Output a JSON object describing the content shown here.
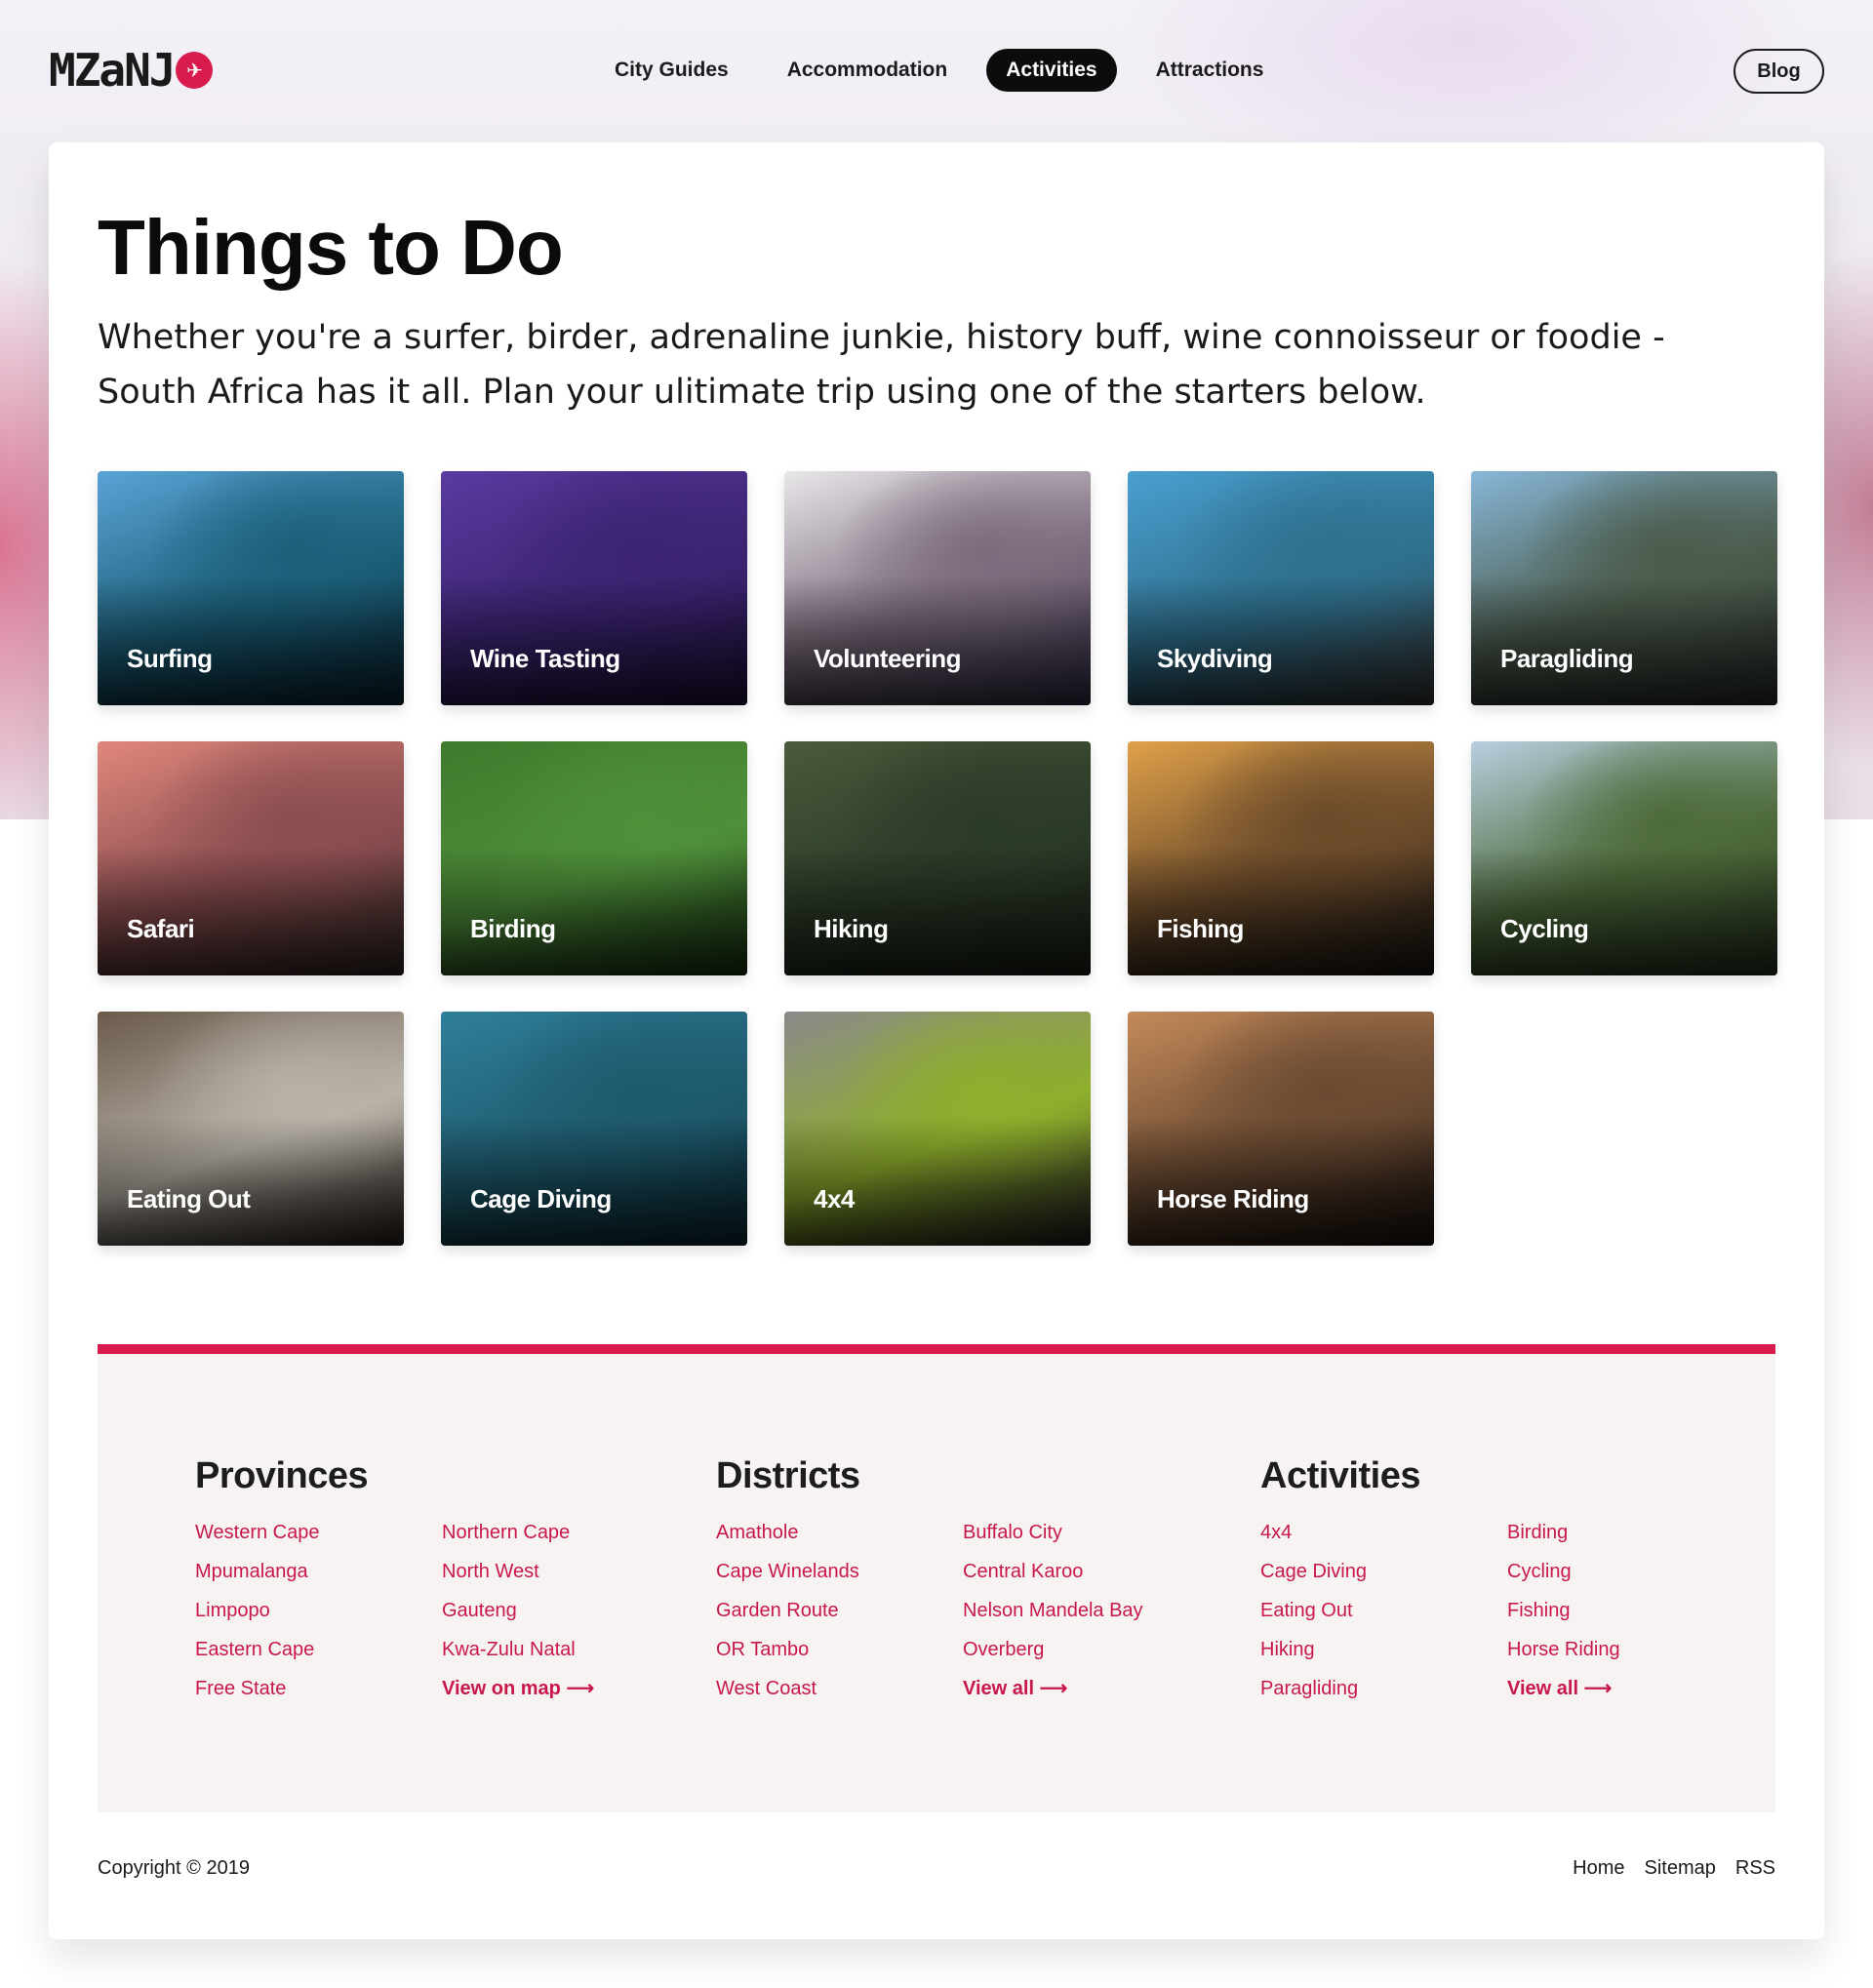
{
  "brand": {
    "logo_text": "MZaNJ",
    "logo_mark": "✈"
  },
  "nav": {
    "items": [
      {
        "label": "City Guides"
      },
      {
        "label": "Accommodation"
      },
      {
        "label": "Activities"
      },
      {
        "label": "Attractions"
      }
    ],
    "active": "Activities",
    "blog_label": "Blog"
  },
  "page": {
    "title": "Things to Do",
    "intro": "Whether you're a surfer, birder, adrenaline junkie, history buff, wine connoisseur or foodie - South Africa has it all. Plan your ulitimate trip using one of the starters below."
  },
  "activities": [
    {
      "label": "Surfing",
      "colors": [
        "#5aa3d6",
        "#1b5f79",
        "#0b2a3a"
      ]
    },
    {
      "label": "Wine Tasting",
      "colors": [
        "#5a3aa0",
        "#3b2472",
        "#241243"
      ]
    },
    {
      "label": "Volunteering",
      "colors": [
        "#e9e7ea",
        "#7b6b7c",
        "#3b3450"
      ]
    },
    {
      "label": "Skydiving",
      "colors": [
        "#4a9fd0",
        "#2e6f8d",
        "#3b3b3b"
      ]
    },
    {
      "label": "Paragliding",
      "colors": [
        "#88b7d8",
        "#4b5b4c",
        "#2e3530"
      ]
    },
    {
      "label": "Safari",
      "colors": [
        "#e0877c",
        "#8b4d50",
        "#3a2c2a"
      ]
    },
    {
      "label": "Birding",
      "colors": [
        "#3f7a2c",
        "#4f8f3a",
        "#1c3a14"
      ]
    },
    {
      "label": "Hiking",
      "colors": [
        "#4a5a3a",
        "#2c3a28",
        "#1c2418"
      ]
    },
    {
      "label": "Fishing",
      "colors": [
        "#e0a14a",
        "#6b4a2a",
        "#1e1a16"
      ]
    },
    {
      "label": "Cycling",
      "colors": [
        "#b9cfe0",
        "#4d6a3a",
        "#2c3a24"
      ]
    },
    {
      "label": "Eating Out",
      "colors": [
        "#6a5a4a",
        "#b8b2a8",
        "#2e2620"
      ]
    },
    {
      "label": "Cage Diving",
      "colors": [
        "#2f7f9a",
        "#1e5a6d",
        "#0d2e3a"
      ]
    },
    {
      "label": "4x4",
      "colors": [
        "#8a8a8a",
        "#8fae2c",
        "#222222"
      ]
    },
    {
      "label": "Horse Riding",
      "colors": [
        "#c48a5a",
        "#6a4a32",
        "#1e1510"
      ]
    }
  ],
  "footer": {
    "provinces": {
      "title": "Provinces",
      "col1": [
        "Western Cape",
        "Mpumalanga",
        "Limpopo",
        "Eastern Cape",
        "Free State"
      ],
      "col2": [
        "Northern Cape",
        "North West",
        "Gauteng",
        "Kwa-Zulu Natal"
      ],
      "more": "View on map ⟶"
    },
    "districts": {
      "title": "Districts",
      "col1": [
        "Amathole",
        "Cape Winelands",
        "Garden Route",
        "OR Tambo",
        "West Coast"
      ],
      "col2": [
        "Buffalo City",
        "Central Karoo",
        "Nelson Mandela Bay",
        "Overberg"
      ],
      "more": "View all ⟶"
    },
    "activities": {
      "title": "Activities",
      "col1": [
        "4x4",
        "Cage Diving",
        "Eating Out",
        "Hiking",
        "Paragliding"
      ],
      "col2": [
        "Birding",
        "Cycling",
        "Fishing",
        "Horse Riding"
      ],
      "more": "View all ⟶"
    },
    "copyright": "Copyright © 2019",
    "links": [
      "Home",
      "Sitemap",
      "RSS"
    ]
  },
  "colors": {
    "accent": "#d81b4c",
    "footer_bg": "#f7f3f2"
  }
}
